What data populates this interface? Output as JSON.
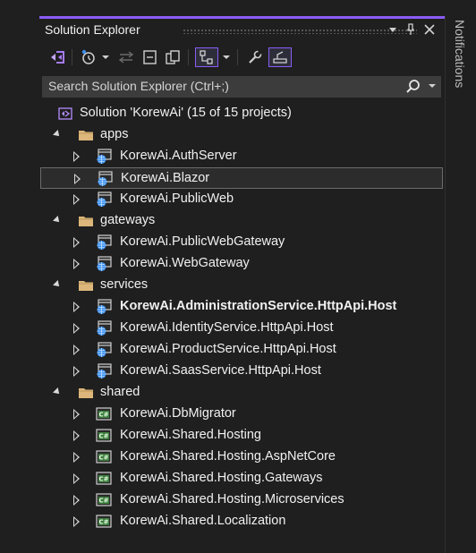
{
  "panel": {
    "title": "Solution Explorer",
    "accent": "#8a5cf5"
  },
  "search": {
    "placeholder": "Search Solution Explorer (Ctrl+;)"
  },
  "side_tab": {
    "label": "Notifications"
  },
  "tree": {
    "solution": "Solution 'KorewAi' (15 of 15 projects)",
    "folders": [
      {
        "name": "apps",
        "items": [
          {
            "label": "KorewAi.AuthServer",
            "kind": "web"
          },
          {
            "label": "KorewAi.Blazor",
            "kind": "web",
            "selected": true
          },
          {
            "label": "KorewAi.PublicWeb",
            "kind": "web"
          }
        ]
      },
      {
        "name": "gateways",
        "items": [
          {
            "label": "KorewAi.PublicWebGateway",
            "kind": "web"
          },
          {
            "label": "KorewAi.WebGateway",
            "kind": "web"
          }
        ]
      },
      {
        "name": "services",
        "items": [
          {
            "label": "KorewAi.AdministrationService.HttpApi.Host",
            "kind": "web",
            "bold": true
          },
          {
            "label": "KorewAi.IdentityService.HttpApi.Host",
            "kind": "web"
          },
          {
            "label": "KorewAi.ProductService.HttpApi.Host",
            "kind": "web"
          },
          {
            "label": "KorewAi.SaasService.HttpApi.Host",
            "kind": "web"
          }
        ]
      },
      {
        "name": "shared",
        "items": [
          {
            "label": "KorewAi.DbMigrator",
            "kind": "csharp"
          },
          {
            "label": "KorewAi.Shared.Hosting",
            "kind": "csharp"
          },
          {
            "label": "KorewAi.Shared.Hosting.AspNetCore",
            "kind": "csharp"
          },
          {
            "label": "KorewAi.Shared.Hosting.Gateways",
            "kind": "csharp"
          },
          {
            "label": "KorewAi.Shared.Hosting.Microservices",
            "kind": "csharp"
          },
          {
            "label": "KorewAi.Shared.Localization",
            "kind": "csharp"
          }
        ]
      }
    ]
  }
}
